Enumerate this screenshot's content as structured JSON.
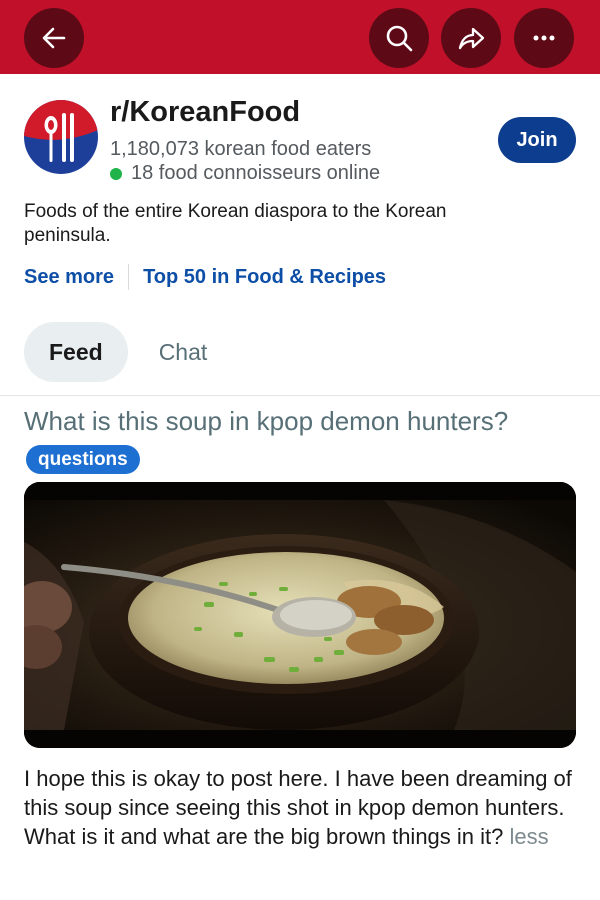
{
  "topbar": {
    "color": "#c0102a",
    "button_color": "#5e0a16",
    "back_icon": "arrow-left-icon",
    "search_icon": "search-icon",
    "share_icon": "share-icon",
    "more_icon": "more-dots-icon"
  },
  "community": {
    "name": "r/KoreanFood",
    "members": "1,180,073 korean food eaters",
    "online": "18 food connoisseurs online",
    "join_label": "Join",
    "description": "Foods of the entire Korean diaspora to the Korean peninsula.",
    "see_more": "See more",
    "ranking": "Top 50 in Food & Recipes",
    "avatar_icon": "spoon-chopsticks-icon"
  },
  "tabs": [
    {
      "label": "Feed",
      "active": true
    },
    {
      "label": "Chat",
      "active": false
    }
  ],
  "post": {
    "title": "What is this soup in kpop demon hunters?",
    "flair": "questions",
    "image": "soup-bowl-image",
    "body": "I hope this is okay to post here. I have been dreaming of this soup since seeing this shot in kpop demon hunters. What is it and what are the big brown things in it?",
    "less_label": "less"
  },
  "colors": {
    "link": "#0d4ea6",
    "join": "#0d3d8e",
    "flair": "#1d6fd1",
    "online_dot": "#1fb34a"
  }
}
